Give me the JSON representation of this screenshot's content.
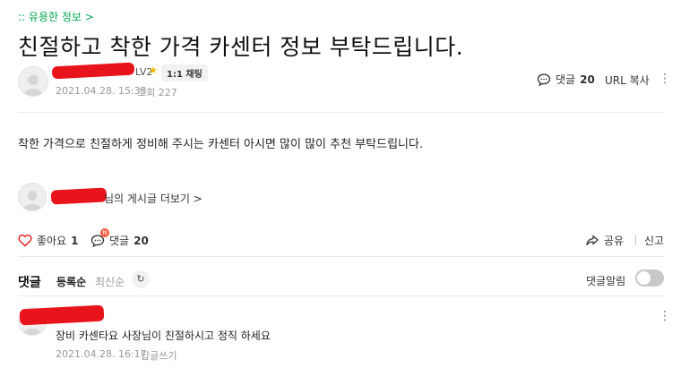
{
  "header": {
    "board_link": ":: 유용한 정보 >",
    "title": "친절하고 착한 가격 카센터 정보 부탁드립니다."
  },
  "author": {
    "level": "LV2",
    "chat_badge": "1:1 채팅",
    "date": "2021.04.28. 15:33",
    "views": "조회 227"
  },
  "top_actions": {
    "comment_label": "댓글",
    "comment_count": "20",
    "url_copy": "URL 복사"
  },
  "post": {
    "body": "착한 가격으로 친절하게 정비해 주시는 카센터 아시면 많이 많이 추천 부탁드립니다."
  },
  "author_posts": {
    "link": "님의 게시글 더보기 >"
  },
  "bottom_actions": {
    "like_label": "좋아요",
    "like_count": "1",
    "comment_label": "댓글",
    "comment_count": "20",
    "new_badge": "N",
    "share_label": "공유",
    "report_label": "신고"
  },
  "comments": {
    "section_title": "댓글",
    "sort_registered": "등록순",
    "sort_latest": "최신순",
    "alarm_label": "댓글알림",
    "items": [
      {
        "text": "장비 카센타요 사장님이 친절하시고 정직 하세요",
        "date": "2021.04.28. 16:17",
        "reply": "답글쓰기"
      }
    ]
  },
  "icons": {
    "star": "star-icon",
    "heart": "heart-icon",
    "comment": "comment-icon",
    "share": "share-icon",
    "more": "more-vertical-icon",
    "refresh": "refresh-icon"
  },
  "colors": {
    "accent_green": "#03a94f",
    "heart_red": "#e8141b",
    "badge_red": "#ff5a3c"
  }
}
